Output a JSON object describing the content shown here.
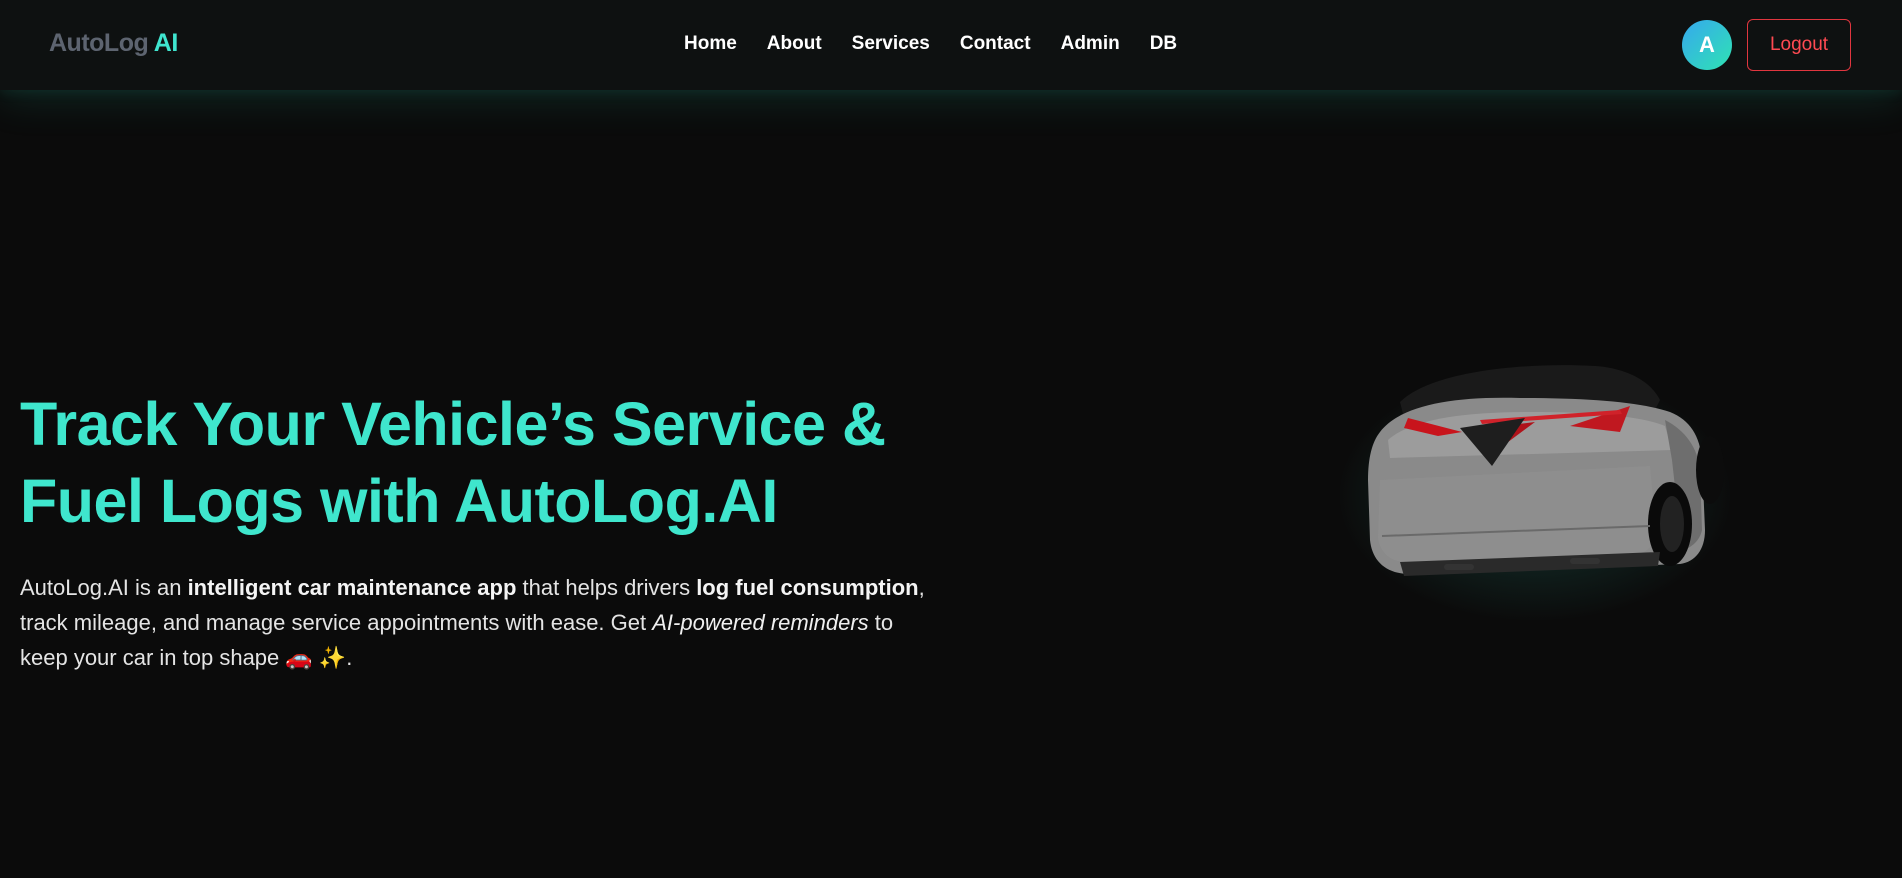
{
  "brand": {
    "main": "AutoLog",
    "accent": "AI"
  },
  "nav": {
    "links": [
      "Home",
      "About",
      "Services",
      "Contact",
      "Admin",
      "DB"
    ]
  },
  "user": {
    "avatar_initial": "A",
    "logout_label": "Logout"
  },
  "hero": {
    "title_line1": "Track Your Vehicle’s Service &",
    "title_line2": "Fuel Logs with AutoLog.AI",
    "desc": {
      "t1": "AutoLog.AI is an ",
      "b1": "intelligent car maintenance app",
      "t2": " that helps drivers ",
      "b2": "log fuel consumption",
      "t3": ", track mileage, and manage service appointments with ease. Get ",
      "i1": "AI-powered reminders",
      "t4": " to keep your car in top shape ",
      "emoji": "🚗 ✨",
      "t5": "."
    }
  },
  "colors": {
    "accent": "#3fe6cd",
    "background": "#0b0b0b",
    "logout": "#e0363f"
  },
  "icons": {
    "car_render": "car-3d-image",
    "emoji": "car-sparkles-icon"
  }
}
